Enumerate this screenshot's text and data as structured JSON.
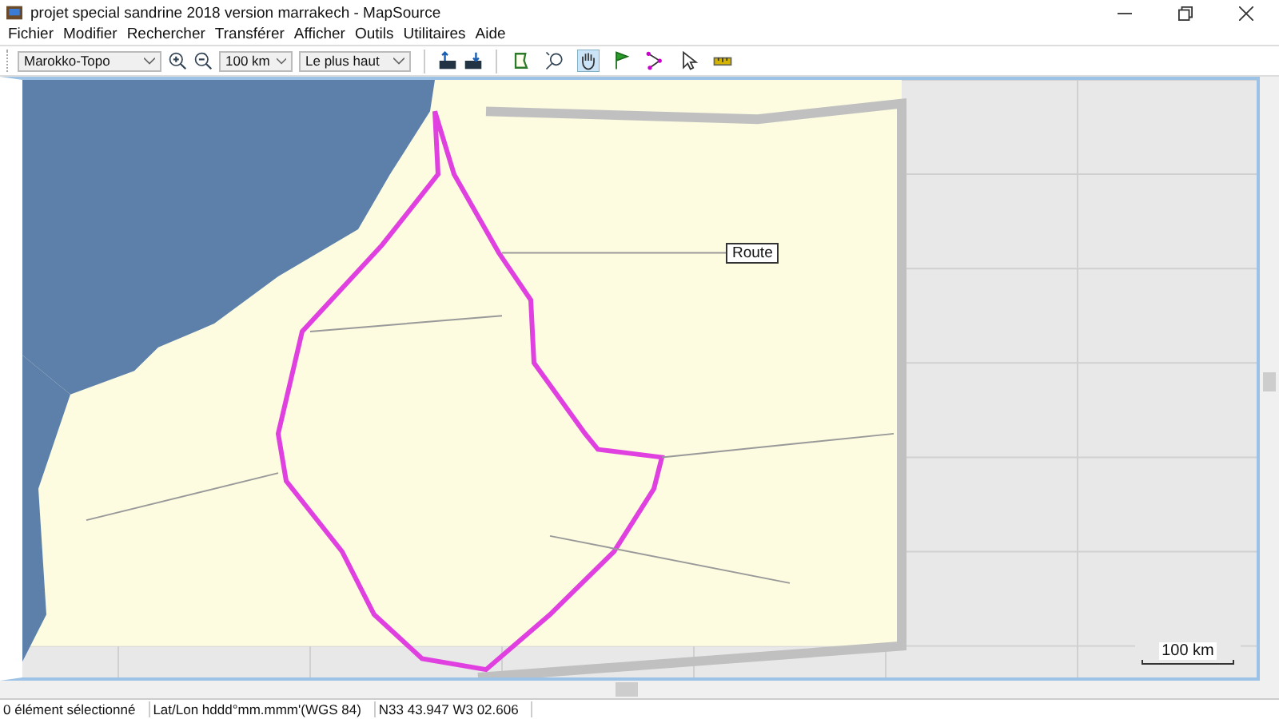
{
  "window": {
    "title": "projet special sandrine 2018 version marrakech - MapSource"
  },
  "menu": [
    "Fichier",
    "Modifier",
    "Rechercher",
    "Transférer",
    "Afficher",
    "Outils",
    "Utilitaires",
    "Aide"
  ],
  "toolbar": {
    "product": "Marokko-Topo",
    "zoom": "100 km",
    "detail": "Le plus haut",
    "tools": [
      {
        "kind": "select-map",
        "selected": false
      },
      {
        "kind": "zoom",
        "selected": false
      },
      {
        "kind": "hand",
        "selected": true
      },
      {
        "kind": "flag",
        "selected": false
      },
      {
        "kind": "route",
        "selected": false
      },
      {
        "kind": "pointer",
        "selected": false
      },
      {
        "kind": "ruler",
        "selected": false
      }
    ]
  },
  "map": {
    "tooltip": "Route",
    "scale": "100 km"
  },
  "status_bar": [
    "0 élément sélectionné",
    "Lat/Lon hddd°mm.mmm'(WGS 84)",
    "N33 43.947 W3 02.606"
  ]
}
